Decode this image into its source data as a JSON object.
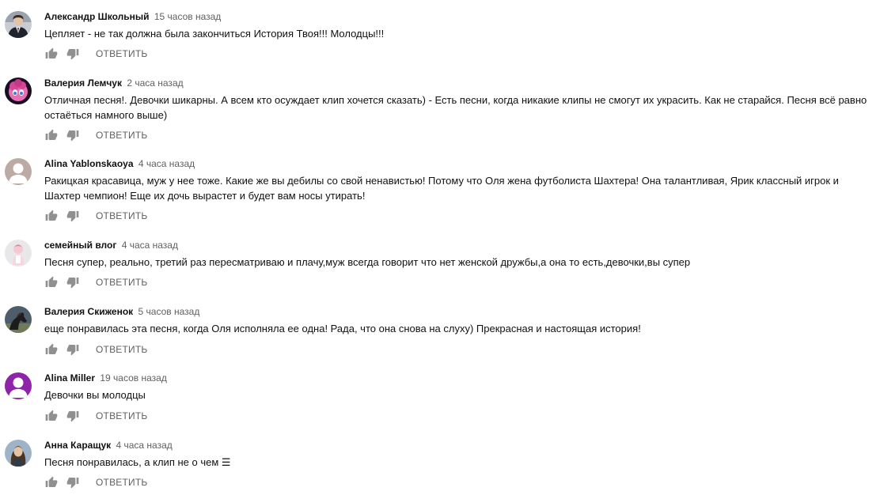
{
  "reply_label": "ОТВЕТИТЬ",
  "icons": {
    "like": "thumb-up-icon",
    "dislike": "thumb-down-icon"
  },
  "colors": {
    "author": "#111111",
    "timestamp": "#606060",
    "action": "#606060"
  },
  "comments": [
    {
      "author": "Александр Школьный",
      "time": "15 часов назад",
      "text": "Цепляет  - не так должна  была закончиться История Твоя!!! Молодцы!!!",
      "avatar": "man-in-suit-avatar"
    },
    {
      "author": "Валерия Лемчук",
      "time": "2 часа назад",
      "text": "Отличная песня!. Девочки шикарны. А всем кто осуждает клип хочется сказать) - Есть песни, когда никакие клипы не смогут их украсить. Как не старайся. Песня всё равно остаёться намного выше)",
      "avatar": "pink-pony-avatar"
    },
    {
      "author": "Alina Yablonskaoya",
      "time": "4 часа назад",
      "text": "Ракицкая красавица, муж у нее тоже. Какие же вы дебилы со свой ненавистью! Потому что Оля жена футболиста Шахтера! Она талантливая, Ярик классный игрок и Шахтер чемпион! Еще их дочь вырастет и будет вам носы утирать!",
      "avatar": "default-avatar"
    },
    {
      "author": "семейный влог",
      "time": "4 часа назад",
      "text": "Песня супер, реально, третий раз пересматриваю и плачу,муж всегда говорит что нет женской дружбы,а она то есть,девочки,вы супер",
      "avatar": "toy-figure-avatar"
    },
    {
      "author": "Валерия Скиженок",
      "time": "5 часов назад",
      "text": "еще понравилась эта песня, когда Оля исполняла ее одна! Рада, что она снова на слуху) Прекрасная и настоящая история!",
      "avatar": "dark-horse-avatar"
    },
    {
      "author": "Alina Miller",
      "time": "19 часов назад",
      "text": "Девочки вы молодцы",
      "avatar": "purple-letter-avatar"
    },
    {
      "author": "Анна Каращук",
      "time": "4 часа назад",
      "text": "Песня понравилась, а клип не о чем ☰",
      "avatar": "woman-photo-avatar"
    }
  ]
}
